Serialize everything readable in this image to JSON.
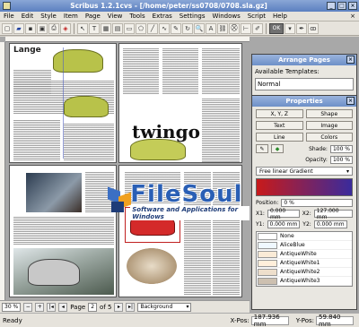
{
  "window": {
    "title": "Scribus 1.2.1cvs - [/home/peter/ss0708/0708.sla.gz]"
  },
  "menu": [
    "File",
    "Edit",
    "Style",
    "Item",
    "Page",
    "View",
    "Tools",
    "Extras",
    "Settings",
    "Windows",
    "Script",
    "Help"
  ],
  "toolbar": {
    "ok_label": "OK",
    "label_text": "Text"
  },
  "pages": {
    "left_label": "Lange",
    "right_label": "twingo"
  },
  "watermark": {
    "name": "FileSoul",
    "tagline": "Software and Applications for Windows"
  },
  "navigation": {
    "zoom": "30 %",
    "page_label": "Page",
    "page_current": "2",
    "page_of": "of 5",
    "layer": "Background"
  },
  "status": {
    "ready": "Ready",
    "xpos_label": "X-Pos:",
    "xpos": "187.936 mm",
    "ypos_label": "Y-Pos:",
    "ypos": "59.840 mm"
  },
  "arrange": {
    "title": "Arrange Pages",
    "templates_label": "Available Templates:",
    "selected_template": "Normal"
  },
  "properties": {
    "title": "Properties",
    "buttons": [
      "X, Y, Z",
      "Shape",
      "Text",
      "Image",
      "Line",
      "Colors"
    ],
    "shade_label": "Shade:",
    "shade": "100 %",
    "opacity_label": "Opacity:",
    "opacity": "100 %",
    "gradient": "Free linear Gradient",
    "position_label": "Position:",
    "position": "0 %",
    "x1_label": "X1:",
    "x1": "0.000 mm",
    "y1_label": "Y1:",
    "y1": "0.000 mm",
    "x2_label": "X2:",
    "x2": "127.000 mm",
    "y2_label": "Y2:",
    "y2": "0.000 mm",
    "colors": [
      {
        "name": "None",
        "hex": "#ffffff"
      },
      {
        "name": "AliceBlue",
        "hex": "#f0f8ff"
      },
      {
        "name": "AntiqueWhite",
        "hex": "#faebd7"
      },
      {
        "name": "AntiqueWhite1",
        "hex": "#ffefdb"
      },
      {
        "name": "AntiqueWhite2",
        "hex": "#eedfcc"
      },
      {
        "name": "AntiqueWhite3",
        "hex": "#cdc0b0"
      }
    ]
  }
}
